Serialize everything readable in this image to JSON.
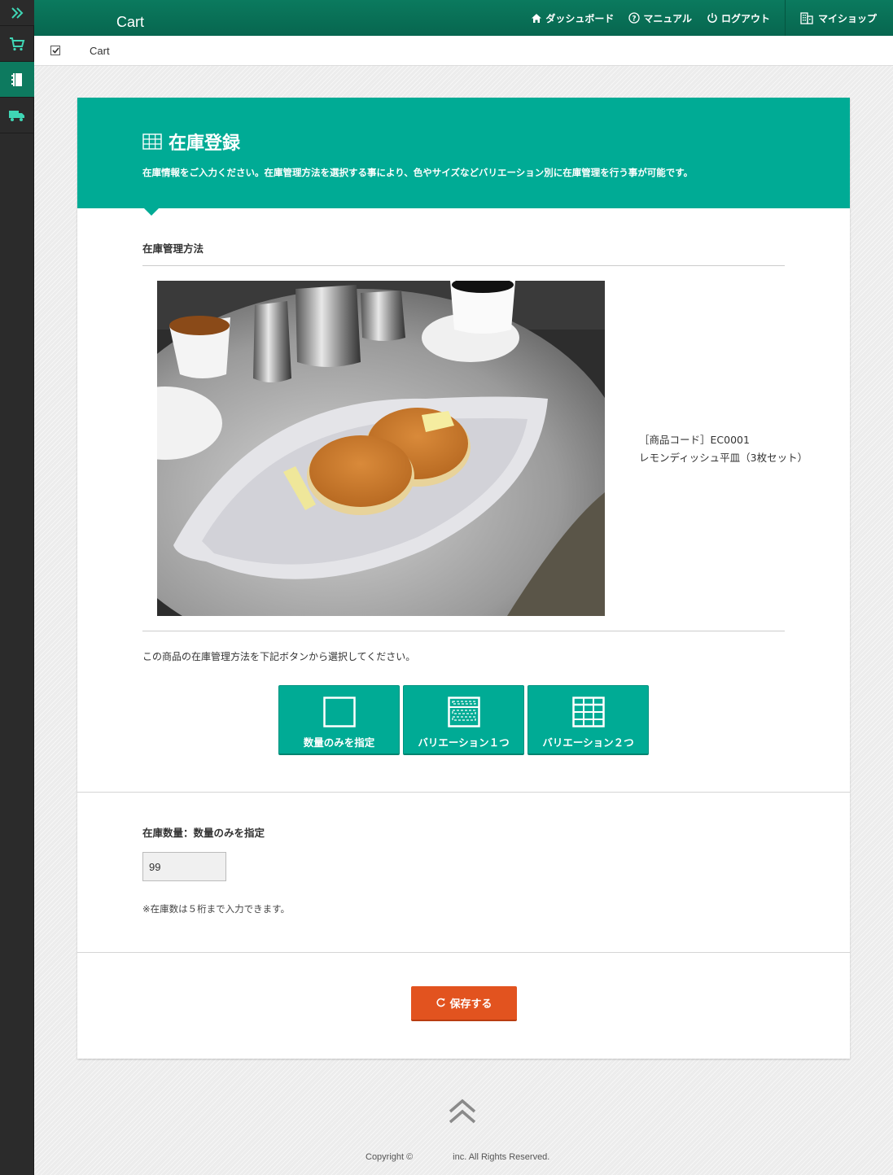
{
  "topbar": {
    "brand": "Cart",
    "nav": {
      "dashboard": "ダッシュボード",
      "manual": "マニュアル",
      "logout": "ログアウト",
      "myshop": "マイショップ"
    }
  },
  "breadcrumb": {
    "label": "Cart"
  },
  "sidebar": {
    "items": [
      "expand-icon",
      "cart-icon",
      "notebook-icon",
      "truck-icon"
    ]
  },
  "colors": {
    "accent": "#00ab95",
    "topbar": "#0b7a5e",
    "save": "#e2531f",
    "sidebar": "#2b2b2b"
  },
  "header": {
    "title": "在庫登録",
    "description": "在庫情報をご入力ください。在庫管理方法を選択する事により、色やサイズなどバリエーション別に在庫管理を行う事が可能です。"
  },
  "method_section": {
    "title": "在庫管理方法",
    "product_code": "［商品コード］EC0001",
    "product_name": "レモンディッシュ平皿（3枚セット）",
    "instruction": "この商品の在庫管理方法を下記ボタンから選択してください。",
    "buttons": [
      "数量のみを指定",
      "バリエーション１つ",
      "バリエーション２つ"
    ]
  },
  "stock_section": {
    "label": "在庫数量：数量のみを指定",
    "value": "99",
    "note": "※在庫数は５桁まで入力できます。"
  },
  "save_label": "保存する",
  "footer": {
    "copyright": "Copyright ©                inc. All Rights Reserved."
  }
}
